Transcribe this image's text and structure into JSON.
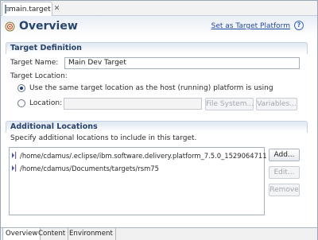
{
  "editor_tab": {
    "label": "main.target",
    "close_symbol": "✕"
  },
  "header": {
    "title": "Overview",
    "platform_link": "Set as Target Platform",
    "help_symbol": "?"
  },
  "target_definition": {
    "section_title": "Target Definition",
    "name_label": "Target Name:",
    "name_value": "Main Dev Target",
    "location_label": "Target Location:",
    "option_same_host": "Use the same target location as the host (running) platform is using",
    "option_same_host_selected": true,
    "option_location": "Location:",
    "option_location_selected": false,
    "location_value": "",
    "file_system_button": "File System...",
    "variables_button": "Variables..."
  },
  "additional_locations": {
    "section_title": "Additional Locations",
    "description": "Specify additional locations to include in this target.",
    "items": [
      "/home/cdamus/.eclipse/ibm.software.delivery.platform_7.5.0_1529064711",
      "/home/cdamus/Documents/targets/rsm75"
    ],
    "add_button": "Add...",
    "edit_button": "Edit...",
    "remove_button": "Remove"
  },
  "bottom_tabs": [
    "Overview",
    "Content",
    "Environment"
  ],
  "colors": {
    "title": "#28456e",
    "link": "#1f47a0",
    "section_title": "#27426a"
  }
}
